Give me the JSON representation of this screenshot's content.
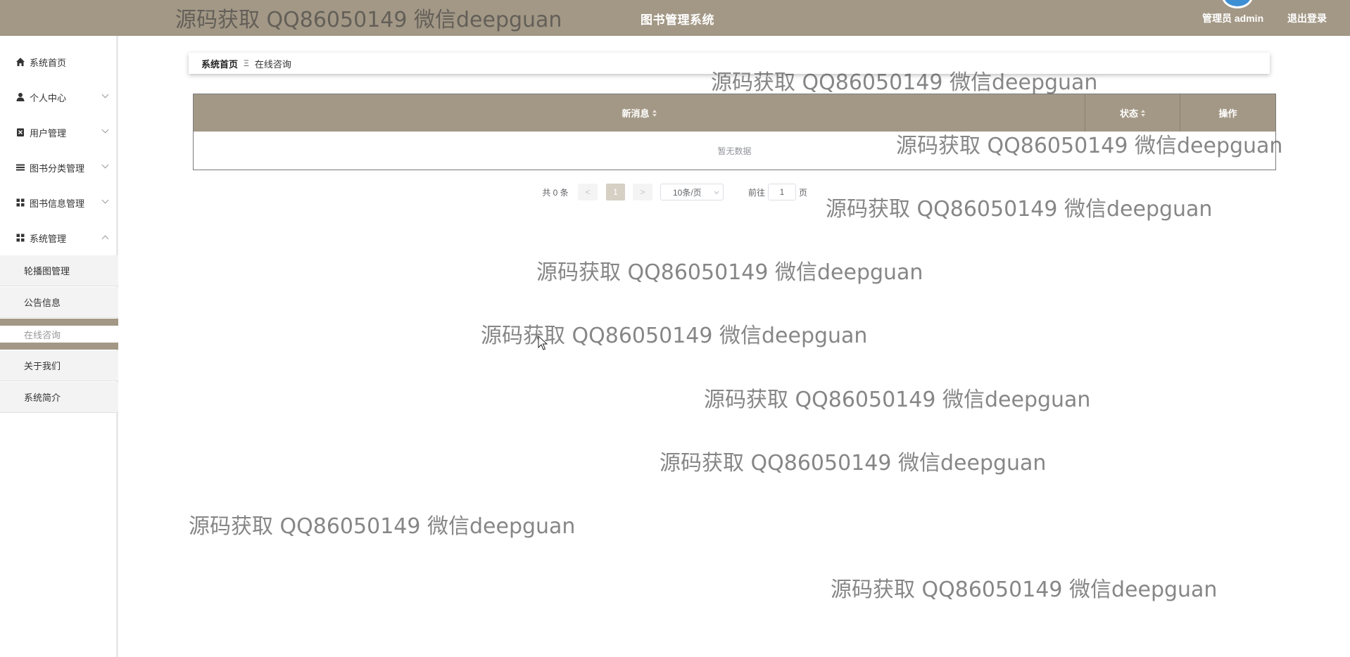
{
  "header": {
    "title": "图书管理系统",
    "admin_label": "管理员 admin",
    "logout_label": "退出登录"
  },
  "sidebar": {
    "items": [
      {
        "label": "系统首页",
        "icon": "home-icon"
      },
      {
        "label": "个人中心",
        "icon": "user-icon"
      },
      {
        "label": "用户管理",
        "icon": "user-manage-icon"
      },
      {
        "label": "图书分类管理",
        "icon": "list-icon"
      },
      {
        "label": "图书信息管理",
        "icon": "grid-icon"
      },
      {
        "label": "系统管理",
        "icon": "grid-icon"
      }
    ],
    "submenu": [
      {
        "label": "轮播图管理"
      },
      {
        "label": "公告信息"
      },
      {
        "label": "在线咨询",
        "active": true
      },
      {
        "label": "关于我们"
      },
      {
        "label": "系统简介"
      }
    ]
  },
  "breadcrumb": {
    "home": "系统首页",
    "separator": "Ξ",
    "current": "在线咨询"
  },
  "table": {
    "columns": [
      "新消息",
      "状态",
      "操作"
    ],
    "empty_text": "暂无数据"
  },
  "pagination": {
    "total_text": "共 0 条",
    "prev": "<",
    "current_page": "1",
    "next": ">",
    "page_size": "10条/页",
    "goto_label": "前往",
    "goto_value": "1",
    "page_suffix": "页"
  },
  "watermark": {
    "text": "源码获取 QQ86050149 微信deepguan"
  },
  "colors": {
    "accent": "#a39886",
    "accent_light": "#d5cfc4"
  }
}
